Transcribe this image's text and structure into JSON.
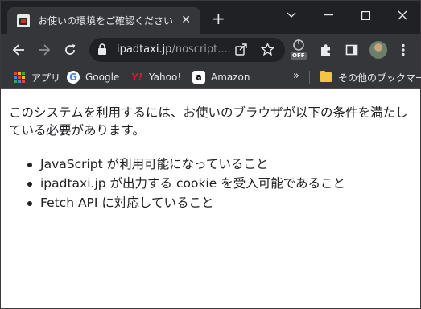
{
  "tab": {
    "title": "お使いの環境をご確認ください",
    "close_glyph": "✕",
    "new_tab_glyph": "+"
  },
  "window_controls": {
    "dropdown_glyph": "⌄",
    "minimize_glyph": "—",
    "maximize_glyph": "☐",
    "close_glyph": "✕"
  },
  "omnibox": {
    "host": "ipadtaxi.jp",
    "path": "/noscript...."
  },
  "extension_badge": "OFF",
  "bookmarks": {
    "items": [
      {
        "label": "アプリ",
        "icon": "apps-grid-icon"
      },
      {
        "label": "Google",
        "icon": "google-icon"
      },
      {
        "label": "Yahoo!",
        "icon": "yahoo-icon"
      },
      {
        "label": "Amazon",
        "icon": "amazon-icon"
      }
    ],
    "overflow_glyph": "»",
    "other_folder": "その他のブックマーク"
  },
  "page": {
    "intro": "このシステムを利用するには、お使いのブラウザが以下の条件を満たしている必要があります。",
    "requirements": [
      "JavaScript が利用可能になっていること",
      "ipadtaxi.jp が出力する cookie を受入可能であること",
      "Fetch API に対応していること"
    ]
  },
  "colors": {
    "titlebar": "#202124",
    "toolbar": "#35363a",
    "text_light": "#e8eaed",
    "apps_grid": [
      "#ea4335",
      "#fbbc04",
      "#34a853",
      "#4285f4",
      "#ea4335",
      "#fbbc04",
      "#34a853",
      "#4285f4",
      "#ea4335"
    ]
  }
}
